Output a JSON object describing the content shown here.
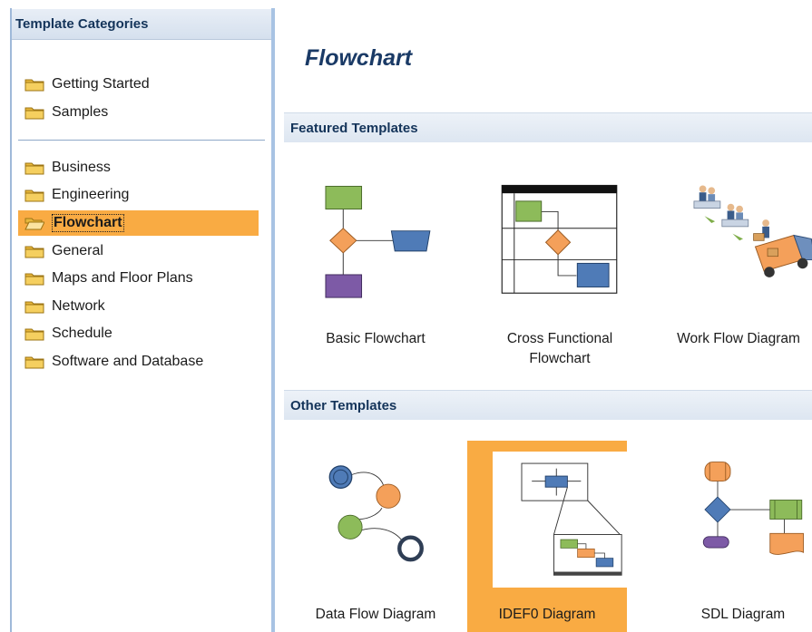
{
  "sidebar": {
    "title": "Template Categories",
    "top_items": [
      {
        "label": "Getting Started"
      },
      {
        "label": "Samples"
      }
    ],
    "items": [
      {
        "label": "Business"
      },
      {
        "label": "Engineering"
      },
      {
        "label": "Flowchart",
        "selected": true
      },
      {
        "label": "General"
      },
      {
        "label": "Maps and Floor Plans"
      },
      {
        "label": "Network"
      },
      {
        "label": "Schedule"
      },
      {
        "label": "Software and Database"
      }
    ]
  },
  "main": {
    "title": "Flowchart",
    "featured": {
      "heading": "Featured Templates",
      "tiles": [
        {
          "label": "Basic Flowchart"
        },
        {
          "label": "Cross Functional Flowchart"
        },
        {
          "label": "Work Flow Diagram"
        }
      ]
    },
    "other": {
      "heading": "Other Templates",
      "tiles": [
        {
          "label": "Data Flow Diagram"
        },
        {
          "label": "IDEF0 Diagram",
          "selected": true
        },
        {
          "label": "SDL Diagram"
        }
      ]
    }
  },
  "colors": {
    "selection": "#f9ab43",
    "header_text": "#14345a",
    "divider": "#a8c3e3",
    "shape_green": "#8dbb5a",
    "shape_orange": "#f4a05a",
    "shape_blue": "#4f7bb7",
    "shape_purple": "#7d5aa6"
  }
}
